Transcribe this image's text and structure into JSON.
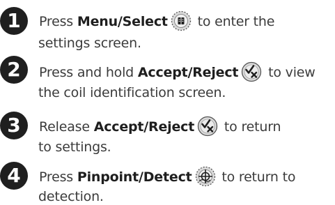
{
  "steps": [
    {
      "number": "1",
      "pre": "Press ",
      "button": "Menu/Select",
      "post": " to enter the",
      "line2": "settings screen.",
      "icon": "menu-select-icon"
    },
    {
      "number": "2",
      "pre": "Press and hold ",
      "button": "Accept/Reject",
      "post": " to view",
      "line2": "the coil identification screen.",
      "icon": "accept-reject-icon"
    },
    {
      "number": "3",
      "pre": "Release ",
      "button": "Accept/Reject",
      "post": " to return",
      "line2": "to settings.",
      "icon": "accept-reject-icon"
    },
    {
      "number": "4",
      "pre": "Press ",
      "button": "Pinpoint/Detect",
      "post": " to return to",
      "line2": "detection.",
      "icon": "pinpoint-detect-icon"
    }
  ],
  "colors": {
    "text": "#3b3b3b",
    "badge": "#1f1f1f",
    "icon_fill": "#d9d9d9"
  }
}
